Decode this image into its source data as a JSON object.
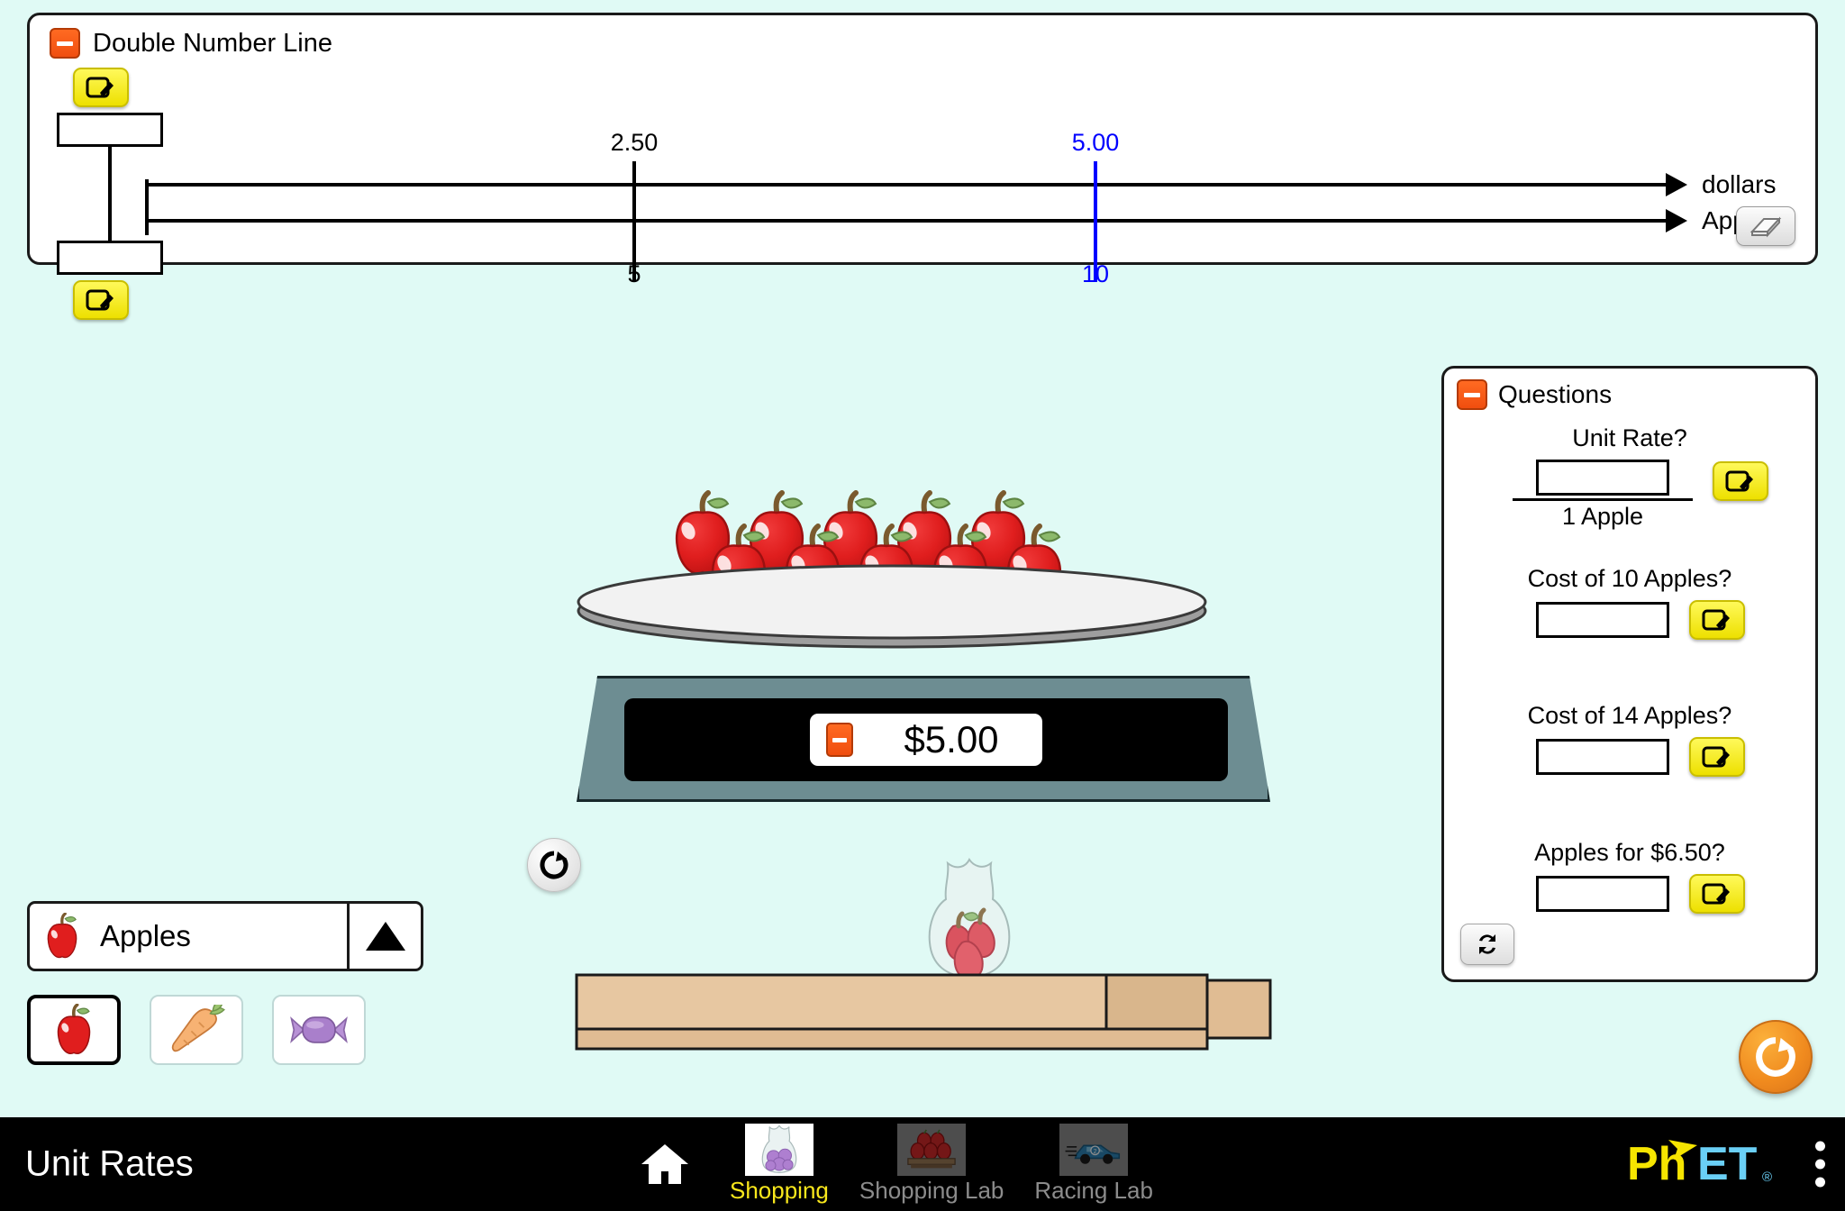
{
  "sim": {
    "title": "Unit Rates",
    "background_color": "#E0FAF5"
  },
  "double_number_line": {
    "title": "Double Number Line",
    "collapse_icon": "minus-icon",
    "top_axis_label": "dollars",
    "bottom_axis_label": "Apples",
    "editor": {
      "top_edit_icon": "pencil-edit-icon",
      "bottom_edit_icon": "pencil-edit-icon",
      "top_value": "",
      "bottom_value": ""
    },
    "eraser_icon": "eraser-icon",
    "markers": [
      {
        "top": "2.50",
        "bottom": "5",
        "color": "#000000",
        "x_percent": 23.0
      },
      {
        "top": "5.00",
        "bottom": "10",
        "color": "#0000FF",
        "x_percent": 46.2
      }
    ]
  },
  "questions": {
    "title": "Questions",
    "collapse_icon": "minus-icon",
    "refresh_icon": "refresh-icon",
    "items": [
      {
        "prompt": "Unit Rate?",
        "value": "",
        "denominator": "1 Apple",
        "edit_icon": "pencil-edit-icon"
      },
      {
        "prompt": "Cost of 10 Apples?",
        "value": "",
        "denominator": "",
        "edit_icon": "pencil-edit-icon"
      },
      {
        "prompt": "Cost of 14 Apples?",
        "value": "",
        "denominator": "",
        "edit_icon": "pencil-edit-icon"
      },
      {
        "prompt": "Apples for $6.50?",
        "value": "",
        "denominator": "",
        "edit_icon": "pencil-edit-icon"
      }
    ]
  },
  "scale": {
    "price_display": "$5.00",
    "collapse_icon": "minus-icon",
    "apple_count": 10,
    "reset_icon": "reset-circle-icon"
  },
  "shelf": {
    "bag_label": "apple-bag"
  },
  "reset_all": {
    "icon": "reset-all-icon",
    "color": "#F08A1E"
  },
  "fruit_selector": {
    "selected_label": "Apples",
    "selected_icon": "apple-icon",
    "arrow_icon": "triangle-up-icon",
    "categories": [
      {
        "name": "apple-category",
        "icon": "apple-icon",
        "selected": true
      },
      {
        "name": "carrot-category",
        "icon": "carrot-icon",
        "selected": false
      },
      {
        "name": "candy-category",
        "icon": "candy-icon",
        "selected": false
      }
    ]
  },
  "navbar": {
    "home_icon": "home-icon",
    "logo_ph": "Ph",
    "logo_et": "ET",
    "logo_reg": "®",
    "menu_icon": "kebab-menu-icon",
    "screens": [
      {
        "label": "Shopping",
        "icon": "candy-bag-icon",
        "active": true
      },
      {
        "label": "Shopping Lab",
        "icon": "apples-icon",
        "active": false
      },
      {
        "label": "Racing Lab",
        "icon": "race-car-icon",
        "active": false
      }
    ]
  }
}
